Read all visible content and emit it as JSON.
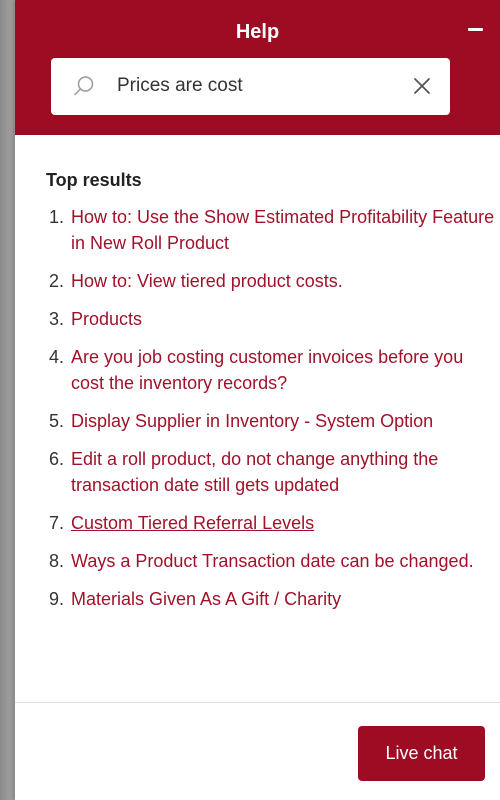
{
  "header": {
    "title": "Help"
  },
  "search": {
    "value": "Prices are cost",
    "placeholder": ""
  },
  "results": {
    "heading": "Top results",
    "items": [
      {
        "number": "1.",
        "label": "How to: Use the Show Estimated Profitability Feature in New Roll Product"
      },
      {
        "number": "2.",
        "label": "How to: View tiered product costs."
      },
      {
        "number": "3.",
        "label": "Products"
      },
      {
        "number": "4.",
        "label": "Are you job costing customer invoices before you cost the inventory records?"
      },
      {
        "number": "5.",
        "label": "Display Supplier in Inventory - System Option"
      },
      {
        "number": "6.",
        "label": "Edit a roll product, do not change anything the transaction date still gets updated"
      },
      {
        "number": "7.",
        "label": "Custom Tiered Referral Levels"
      },
      {
        "number": "8.",
        "label": "Ways a Product Transaction date can be changed."
      },
      {
        "number": "9.",
        "label": "Materials Given As A Gift / Charity"
      }
    ]
  },
  "footer": {
    "live_chat_label": "Live chat"
  },
  "colors": {
    "brand": "#9e0c23",
    "link": "#a1122a"
  },
  "icons": {
    "search": "search-icon",
    "clear": "close-icon",
    "minimize": "minimize-icon"
  }
}
